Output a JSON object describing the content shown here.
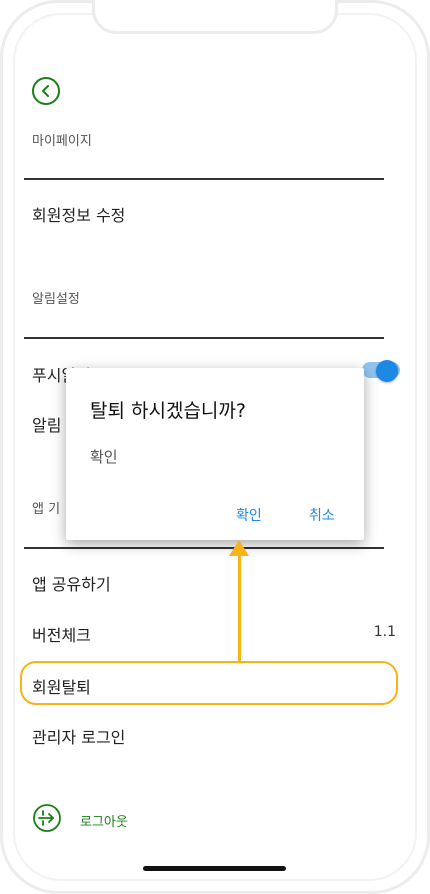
{
  "header": {
    "back_label": "",
    "section_title": "마이페이지"
  },
  "menu": {
    "edit_profile": "회원정보 수정",
    "notification_section": "알림설정",
    "push_notification": "푸시알림",
    "notification_partial": "알림",
    "app_partial": "앱 기",
    "share_app": "앱 공유하기",
    "version_check": "버전체크",
    "version_value": "1.1",
    "withdraw": "회원탈퇴",
    "admin_login": "관리자 로그인"
  },
  "toggle": {
    "push_enabled": true
  },
  "dialog": {
    "title": "탈퇴 하시겠습니까?",
    "message": "확인",
    "confirm_label": "확인",
    "cancel_label": "취소"
  },
  "footer": {
    "logout_label": "로그아웃"
  },
  "colors": {
    "accent_green": "#1a7f1a",
    "accent_blue": "#1e88e5",
    "highlight_orange": "#f7b318"
  }
}
